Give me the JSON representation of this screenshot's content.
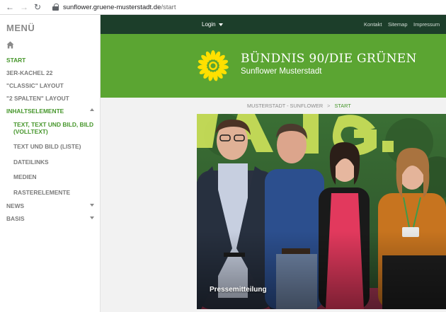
{
  "browser": {
    "back_icon": "arrow-left-icon",
    "forward_icon": "arrow-right-icon",
    "reload_icon": "reload-icon",
    "url_host": "sunflower.gruene-musterstadt.de",
    "url_path": "/start"
  },
  "sidebar": {
    "title": "MENÜ",
    "home_icon": "home-icon",
    "items": [
      {
        "label": "START"
      },
      {
        "label": "3ER-KACHEL 22"
      },
      {
        "label": "\"CLASSIC\" LAYOUT"
      },
      {
        "label": "\"2 SPALTEN\" LAYOUT"
      },
      {
        "label": "INHALTSELEMENTE"
      },
      {
        "label": "TEXT, TEXT UND BILD, BILD (VOLLTEXT)"
      },
      {
        "label": "TEXT UND BILD (LISTE)"
      },
      {
        "label": "DATEILINKS"
      },
      {
        "label": "MEDIEN"
      },
      {
        "label": "RASTERELEMENTE"
      },
      {
        "label": "NEWS"
      },
      {
        "label": "BASIS"
      }
    ]
  },
  "topbar": {
    "login": "Login",
    "links": [
      "Kontakt",
      "Sitemap",
      "Impressum"
    ]
  },
  "header": {
    "title": "BÜNDNIS 90/DIE GRÜNEN",
    "subtitle": "Sunflower Musterstadt",
    "logo_icon": "sunflower-icon"
  },
  "breadcrumb": {
    "root": "MUSTERSTADT - SUNFLOWER",
    "separator": ">",
    "current": "START"
  },
  "hero": {
    "caption": "Pressemitteilung"
  },
  "colors": {
    "green": "#46962b",
    "dark_green": "#1c3e2a",
    "header_green": "#5ba532",
    "sun_yellow": "#ffe000"
  }
}
